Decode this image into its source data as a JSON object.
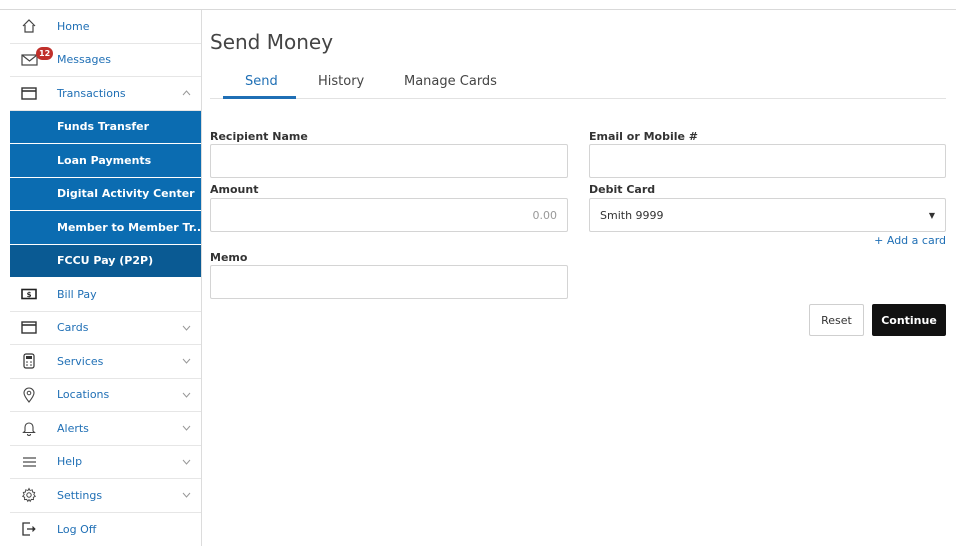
{
  "sidebar": {
    "items": [
      {
        "label": "Home"
      },
      {
        "label": "Messages",
        "badge": "12"
      },
      {
        "label": "Transactions"
      },
      {
        "label": "Bill Pay"
      },
      {
        "label": "Cards"
      },
      {
        "label": "Services"
      },
      {
        "label": "Locations"
      },
      {
        "label": "Alerts"
      },
      {
        "label": "Help"
      },
      {
        "label": "Settings"
      },
      {
        "label": "Log Off"
      }
    ],
    "subitems": [
      {
        "label": "Funds Transfer"
      },
      {
        "label": "Loan Payments"
      },
      {
        "label": "Digital Activity Center"
      },
      {
        "label": "Member to Member Tr..."
      },
      {
        "label": "FCCU Pay (P2P)"
      }
    ]
  },
  "main": {
    "title": "Send Money",
    "tabs": [
      {
        "label": "Send"
      },
      {
        "label": "History"
      },
      {
        "label": "Manage Cards"
      }
    ],
    "form": {
      "recipient_label": "Recipient Name",
      "recipient_value": "",
      "email_label": "Email or Mobile #",
      "email_value": "",
      "amount_label": "Amount",
      "amount_placeholder": "0.00",
      "debit_label": "Debit Card",
      "debit_value": "Smith 9999",
      "add_card": "+ Add a card",
      "memo_label": "Memo",
      "memo_value": ""
    },
    "buttons": {
      "reset": "Reset",
      "continue": "Continue"
    }
  },
  "colors": {
    "accent": "#1f6fb5",
    "submenu": "#0b6cb1",
    "submenu_active": "#0a5a93",
    "badge": "#c0302b"
  }
}
